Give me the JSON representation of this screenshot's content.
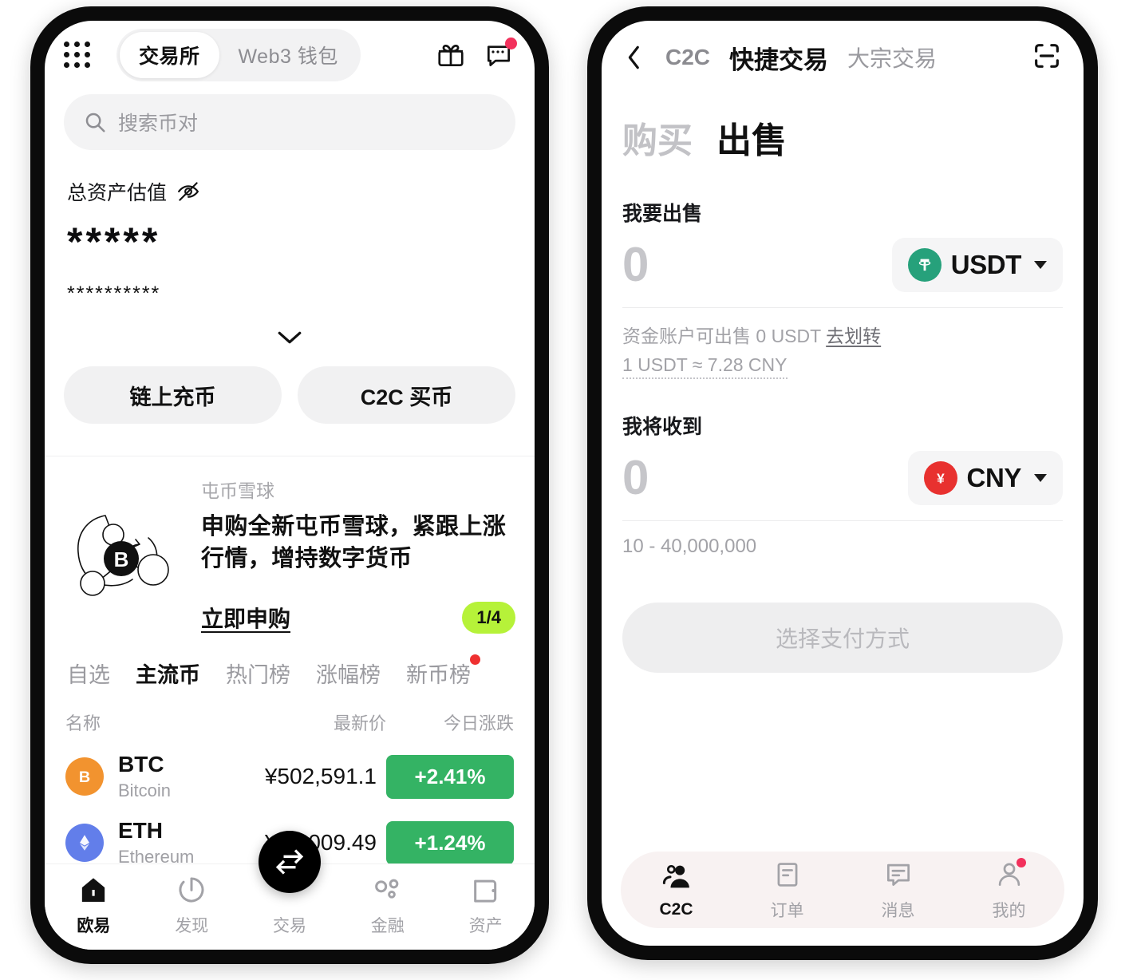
{
  "left": {
    "topbar": {
      "grid_icon": "apps-grid-icon",
      "segments": [
        {
          "label": "交易所",
          "active": true
        },
        {
          "label": "Web3 钱包",
          "active": false
        }
      ],
      "gift_icon": "gift-icon",
      "chat_icon": "chat-bubble-icon",
      "chat_has_badge": true
    },
    "search": {
      "placeholder": "搜索币对",
      "icon": "search-icon"
    },
    "assets": {
      "label": "总资产估值",
      "eye_icon": "eye-off-icon",
      "masked_primary": "*****",
      "masked_secondary": "**********",
      "expand_icon": "chevron-down-icon"
    },
    "actions": [
      {
        "label": "链上充币"
      },
      {
        "label": "C2C 买币"
      }
    ],
    "promo": {
      "kicker": "屯币雪球",
      "title": "申购全新屯币雪球，紧跟上涨行情，增持数字货币",
      "link": "立即申购",
      "pager": "1/4",
      "pager_color": "#b6f239",
      "art_icon": "bitcoin-snowball-illustration"
    },
    "market": {
      "tabs": [
        {
          "label": "自选",
          "active": false,
          "dot": false
        },
        {
          "label": "主流币",
          "active": true,
          "dot": false
        },
        {
          "label": "热门榜",
          "active": false,
          "dot": false
        },
        {
          "label": "涨幅榜",
          "active": false,
          "dot": false
        },
        {
          "label": "新币榜",
          "active": false,
          "dot": true
        }
      ],
      "columns": {
        "name": "名称",
        "price": "最新价",
        "change": "今日涨跌"
      },
      "rows": [
        {
          "symbol": "BTC",
          "name": "Bitcoin",
          "price": "¥502,591.1",
          "change": "+2.41%",
          "change_color": "#34b364",
          "icon": "bitcoin-icon",
          "icon_color": "#f2932f",
          "glyph": "₿"
        },
        {
          "symbol": "ETH",
          "name": "Ethereum",
          "price": "¥24,009.49",
          "change": "+1.24%",
          "change_color": "#34b364",
          "icon": "ethereum-icon",
          "icon_color": "#627eea",
          "glyph": "◆"
        }
      ]
    },
    "nav": [
      {
        "label": "欧易",
        "icon": "home-icon",
        "active": true
      },
      {
        "label": "发现",
        "icon": "compass-icon",
        "active": false
      },
      {
        "label": "交易",
        "icon": "swap-icon",
        "active": false,
        "fab": true
      },
      {
        "label": "金融",
        "icon": "finance-bubbles-icon",
        "active": false
      },
      {
        "label": "资产",
        "icon": "wallet-icon",
        "active": false
      }
    ]
  },
  "right": {
    "topbar": {
      "back_icon": "back-chevron-icon",
      "scan_icon": "scan-icon",
      "tabs": [
        {
          "label": "C2C",
          "state": "dim"
        },
        {
          "label": "快捷交易",
          "state": "active"
        },
        {
          "label": "大宗交易",
          "state": "normal"
        }
      ]
    },
    "mode_tabs": [
      {
        "label": "购买",
        "active": false
      },
      {
        "label": "出售",
        "active": true
      }
    ],
    "sell": {
      "label": "我要出售",
      "value": "0",
      "token": {
        "name": "USDT",
        "icon": "tether-icon",
        "color": "#26a17b",
        "glyph": "₮"
      },
      "balance_text": "资金账户可出售 0 USDT",
      "transfer_link": "去划转",
      "rate": "1 USDT ≈ 7.28 CNY"
    },
    "receive": {
      "label": "我将收到",
      "value": "0",
      "token": {
        "name": "CNY",
        "icon": "cny-icon",
        "color": "#e8312f",
        "glyph": "¥"
      },
      "range": "10 - 40,000,000"
    },
    "pay_button": {
      "label": "选择支付方式",
      "disabled": true
    },
    "nav": [
      {
        "label": "C2C",
        "icon": "people-icon",
        "active": true,
        "dot": false
      },
      {
        "label": "订单",
        "icon": "order-doc-icon",
        "active": false,
        "dot": false
      },
      {
        "label": "消息",
        "icon": "message-icon",
        "active": false,
        "dot": false
      },
      {
        "label": "我的",
        "icon": "profile-icon",
        "active": false,
        "dot": true
      }
    ]
  }
}
